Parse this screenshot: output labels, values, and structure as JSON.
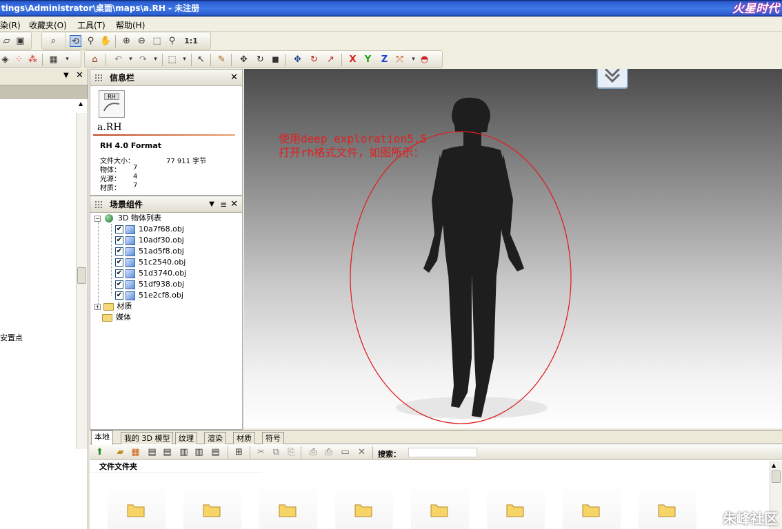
{
  "window": {
    "title": "tings\\Administrator\\桌面\\maps\\a.RH - 未注册",
    "logo_text": "火星时代"
  },
  "menu": [
    {
      "label": "染(R)"
    },
    {
      "label": "收藏夹(O)"
    },
    {
      "label": "工具(T)"
    },
    {
      "label": "帮助(H)"
    }
  ],
  "toolbar": {
    "zoom_label": "1:1",
    "axis_x": "X",
    "axis_y": "Y",
    "axis_z": "Z"
  },
  "left_panel": {
    "label_fragment": "安置点"
  },
  "info_panel": {
    "title": "信息栏",
    "file_icon_text": "RH",
    "file_name": "a.RH",
    "format": "RH 4.0 Format",
    "properties": [
      {
        "label": "文件大小：",
        "value": "77 911 字节"
      },
      {
        "label": "物体：",
        "value": "7"
      },
      {
        "label": "光源：",
        "value": "4"
      },
      {
        "label": "材质：",
        "value": "7"
      }
    ]
  },
  "scene_panel": {
    "title": "场景组件",
    "root": "3D 物体列表",
    "objects": [
      {
        "name": "10a7f68.obj",
        "checked": true
      },
      {
        "name": "10adf30.obj",
        "checked": true
      },
      {
        "name": "51ad5f8.obj",
        "checked": true
      },
      {
        "name": "51c2540.obj",
        "checked": true
      },
      {
        "name": "51d3740.obj",
        "checked": true
      },
      {
        "name": "51df938.obj",
        "checked": true
      },
      {
        "name": "51e2cf8.obj",
        "checked": true
      }
    ],
    "folders": [
      {
        "name": "材质"
      },
      {
        "name": "媒体"
      }
    ]
  },
  "viewport": {
    "annotation_line1": "使用deep exploration5.5",
    "annotation_line2": "打开rh格式文件，如图所示："
  },
  "bottom": {
    "tabs": [
      {
        "label": "本地",
        "active": true
      },
      {
        "label": "我的 3D 模型",
        "active": false
      },
      {
        "label": "纹理",
        "active": false
      },
      {
        "label": "渲染",
        "active": false
      },
      {
        "label": "材质",
        "active": false
      },
      {
        "label": "符号",
        "active": false
      }
    ],
    "search_label": "搜索：",
    "search_value": "",
    "folder_header": "文件文件夹",
    "watermark": "朱峰社区"
  }
}
